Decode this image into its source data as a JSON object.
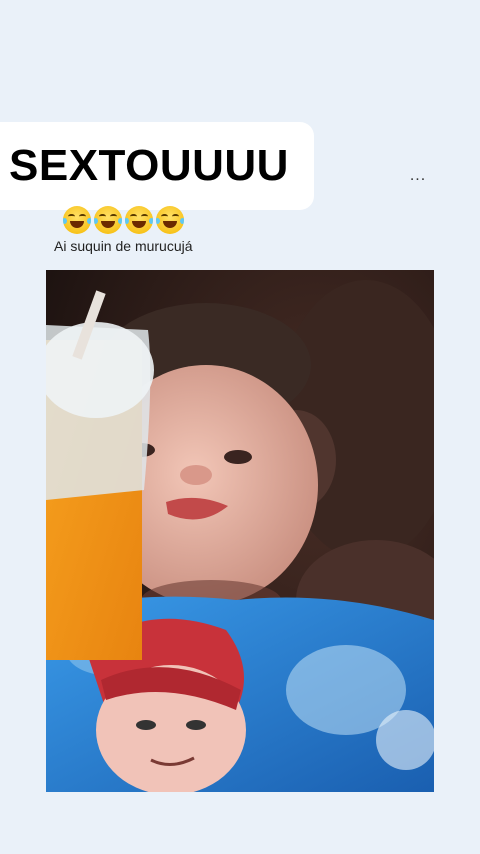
{
  "headline": "SEXTOUUUU",
  "menu": {
    "more_label": "..."
  },
  "emojis": [
    "laughing-with-tears",
    "laughing-with-tears",
    "laughing-with-tears",
    "laughing-with-tears"
  ],
  "caption": "Ai suquin de murucujá",
  "colors": {
    "background": "#eaf1f9",
    "headline_box": "#ffffff",
    "juice": "#f59a1a",
    "shirt": "#2a86d6"
  }
}
